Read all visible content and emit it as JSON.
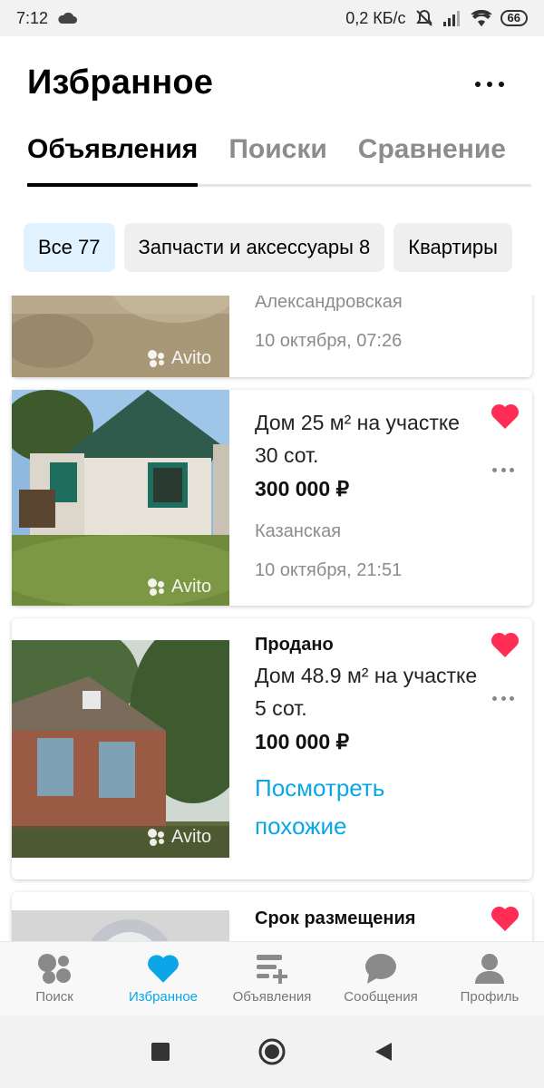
{
  "status_bar": {
    "time": "7:12",
    "network_speed": "0,2 КБ/с",
    "battery": "66"
  },
  "header": {
    "title": "Избранное",
    "more_icon": "more-horizontal-icon"
  },
  "tabs": [
    {
      "label": "Объявления",
      "active": true
    },
    {
      "label": "Поиски",
      "active": false
    },
    {
      "label": "Сравнение",
      "active": false
    }
  ],
  "chips": [
    {
      "label": "Все 77",
      "active": true
    },
    {
      "label": "Запчасти и аксессуары 8",
      "active": false
    },
    {
      "label": "Квартиры",
      "active": false
    }
  ],
  "watermark": "Avito",
  "listings": [
    {
      "location": "Александровская",
      "date": "10 октября, 07:26"
    },
    {
      "name": "Дом 25 м² на участке 30 сот.",
      "price": "300 000 ₽",
      "location": "Казанская",
      "date": "10 октября, 21:51",
      "favorite": true
    },
    {
      "status": "Продано",
      "name": "Дом 48.9 м² на участке 5 сот.",
      "price": "100 000 ₽",
      "link": "Посмотреть похожие",
      "favorite": true
    },
    {
      "status": "Срок размещения",
      "favorite": true
    }
  ],
  "bottom_nav": [
    {
      "label": "Поиск",
      "icon": "avito-logo-icon",
      "active": false
    },
    {
      "label": "Избранное",
      "icon": "heart-icon",
      "active": true
    },
    {
      "label": "Объявления",
      "icon": "add-listing-icon",
      "active": false
    },
    {
      "label": "Сообщения",
      "icon": "chat-bubble-icon",
      "active": false
    },
    {
      "label": "Профиль",
      "icon": "user-icon",
      "active": false
    }
  ],
  "colors": {
    "accent": "#0AA6E8",
    "heart": "#FF2D55",
    "chip_active": "#E0F2FF"
  }
}
